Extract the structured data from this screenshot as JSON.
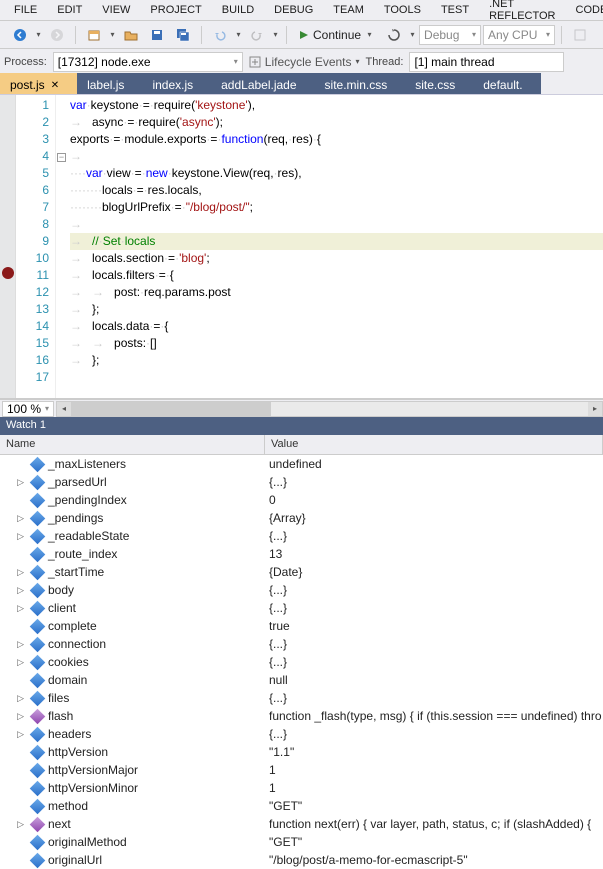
{
  "menu": [
    "FILE",
    "EDIT",
    "VIEW",
    "PROJECT",
    "BUILD",
    "DEBUG",
    "TEAM",
    "TOOLS",
    "TEST",
    ".NET REFLECTOR",
    "CODE"
  ],
  "toolbar": {
    "continue": "Continue",
    "debug_combo": "Debug",
    "cpu_combo": "Any CPU"
  },
  "process": {
    "label": "Process:",
    "value": "[17312] node.exe",
    "lifecycle": "Lifecycle Events",
    "thread_label": "Thread:",
    "thread_value": "[1] main thread"
  },
  "tabs": [
    {
      "label": "post.js",
      "active": true
    },
    {
      "label": "label.js"
    },
    {
      "label": "index.js"
    },
    {
      "label": "addLabel.jade"
    },
    {
      "label": "site.min.css"
    },
    {
      "label": "site.css"
    },
    {
      "label": "default."
    }
  ],
  "code": {
    "lines": [
      1,
      2,
      3,
      4,
      5,
      6,
      7,
      8,
      9,
      10,
      11,
      12,
      13,
      14,
      15,
      16,
      17
    ],
    "breakpoint_line": 11
  },
  "zoom": "100 %",
  "watch": {
    "title": "Watch 1",
    "head_name": "Name",
    "head_value": "Value",
    "rows": [
      {
        "exp": "",
        "icon": "blue",
        "name": "_maxListeners",
        "value": "undefined"
      },
      {
        "exp": "▷",
        "icon": "blue",
        "name": "_parsedUrl",
        "value": "{...}"
      },
      {
        "exp": "",
        "icon": "blue",
        "name": "_pendingIndex",
        "value": "0"
      },
      {
        "exp": "▷",
        "icon": "blue",
        "name": "_pendings",
        "value": "{Array}"
      },
      {
        "exp": "▷",
        "icon": "blue",
        "name": "_readableState",
        "value": "{...}"
      },
      {
        "exp": "",
        "icon": "blue",
        "name": "_route_index",
        "value": "13"
      },
      {
        "exp": "▷",
        "icon": "blue",
        "name": "_startTime",
        "value": "{Date}"
      },
      {
        "exp": "▷",
        "icon": "blue",
        "name": "body",
        "value": "{...}"
      },
      {
        "exp": "▷",
        "icon": "blue",
        "name": "client",
        "value": "{...}"
      },
      {
        "exp": "",
        "icon": "blue",
        "name": "complete",
        "value": "true"
      },
      {
        "exp": "▷",
        "icon": "blue",
        "name": "connection",
        "value": "{...}"
      },
      {
        "exp": "▷",
        "icon": "blue",
        "name": "cookies",
        "value": "{...}"
      },
      {
        "exp": "",
        "icon": "blue",
        "name": "domain",
        "value": "null"
      },
      {
        "exp": "▷",
        "icon": "blue",
        "name": "files",
        "value": "{...}"
      },
      {
        "exp": "▷",
        "icon": "purple",
        "name": "flash",
        "value": "function _flash(type, msg) {  if (this.session === undefined) thro"
      },
      {
        "exp": "▷",
        "icon": "blue",
        "name": "headers",
        "value": "{...}"
      },
      {
        "exp": "",
        "icon": "blue",
        "name": "httpVersion",
        "value": "\"1.1\""
      },
      {
        "exp": "",
        "icon": "blue",
        "name": "httpVersionMajor",
        "value": "1"
      },
      {
        "exp": "",
        "icon": "blue",
        "name": "httpVersionMinor",
        "value": "1"
      },
      {
        "exp": "",
        "icon": "blue",
        "name": "method",
        "value": "\"GET\""
      },
      {
        "exp": "▷",
        "icon": "purple",
        "name": "next",
        "value": "function next(err) {    var layer, path, status, c;    if (slashAdded) {"
      },
      {
        "exp": "",
        "icon": "blue",
        "name": "originalMethod",
        "value": "\"GET\""
      },
      {
        "exp": "",
        "icon": "blue",
        "name": "originalUrl",
        "value": "\"/blog/post/a-memo-for-ecmascript-5\""
      }
    ]
  }
}
